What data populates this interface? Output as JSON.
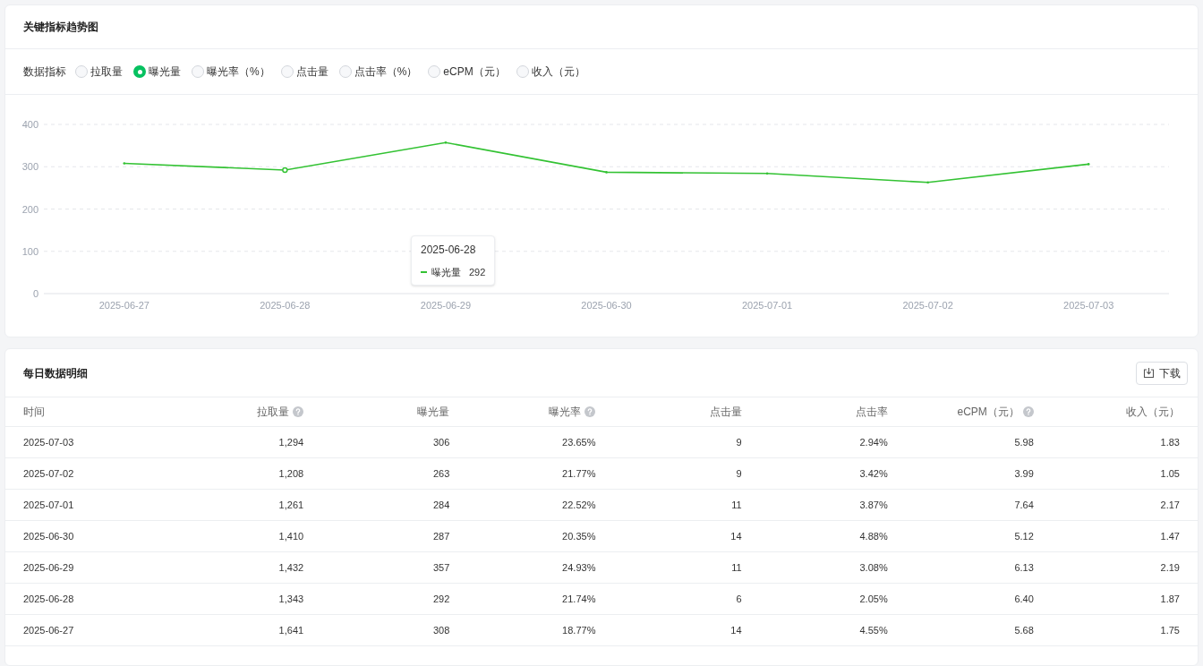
{
  "trend_card": {
    "title": "关键指标趋势图",
    "metric_label": "数据指标",
    "metrics": [
      {
        "label": "拉取量",
        "selected": false
      },
      {
        "label": "曝光量",
        "selected": true
      },
      {
        "label": "曝光率（%）",
        "selected": false
      },
      {
        "label": "点击量",
        "selected": false
      },
      {
        "label": "点击率（%）",
        "selected": false
      },
      {
        "label": "eCPM（元）",
        "selected": false
      },
      {
        "label": "收入（元）",
        "selected": false
      }
    ],
    "chart_data": {
      "type": "line",
      "categories": [
        "2025-06-27",
        "2025-06-28",
        "2025-06-29",
        "2025-06-30",
        "2025-07-01",
        "2025-07-02",
        "2025-07-03"
      ],
      "series": [
        {
          "name": "曝光量",
          "color": "#33c233",
          "values": [
            308,
            292,
            357,
            287,
            284,
            263,
            306
          ]
        }
      ],
      "ylim": [
        0,
        400
      ],
      "yticks": [
        0,
        100,
        200,
        300,
        400
      ],
      "grid": true
    },
    "tooltip": {
      "date": "2025-06-28",
      "value": "292"
    }
  },
  "detail_card": {
    "title": "每日数据明细",
    "download_button": "下载",
    "columns": [
      {
        "label": "时间",
        "help": false
      },
      {
        "label": "拉取量",
        "help": true
      },
      {
        "label": "曝光量",
        "help": false
      },
      {
        "label": "曝光率",
        "help": true
      },
      {
        "label": "点击量",
        "help": false
      },
      {
        "label": "点击率",
        "help": false
      },
      {
        "label": "eCPM（元）",
        "help": true
      },
      {
        "label": "收入（元）",
        "help": false
      }
    ],
    "rows": [
      [
        "2025-07-03",
        "1,294",
        "306",
        "23.65%",
        "9",
        "2.94%",
        "5.98",
        "1.83"
      ],
      [
        "2025-07-02",
        "1,208",
        "263",
        "21.77%",
        "9",
        "3.42%",
        "3.99",
        "1.05"
      ],
      [
        "2025-07-01",
        "1,261",
        "284",
        "22.52%",
        "11",
        "3.87%",
        "7.64",
        "2.17"
      ],
      [
        "2025-06-30",
        "1,410",
        "287",
        "20.35%",
        "14",
        "4.88%",
        "5.12",
        "1.47"
      ],
      [
        "2025-06-29",
        "1,432",
        "357",
        "24.93%",
        "11",
        "3.08%",
        "6.13",
        "2.19"
      ],
      [
        "2025-06-28",
        "1,343",
        "292",
        "21.74%",
        "6",
        "2.05%",
        "6.40",
        "1.87"
      ],
      [
        "2025-06-27",
        "1,641",
        "308",
        "18.77%",
        "14",
        "4.55%",
        "5.68",
        "1.75"
      ]
    ]
  }
}
